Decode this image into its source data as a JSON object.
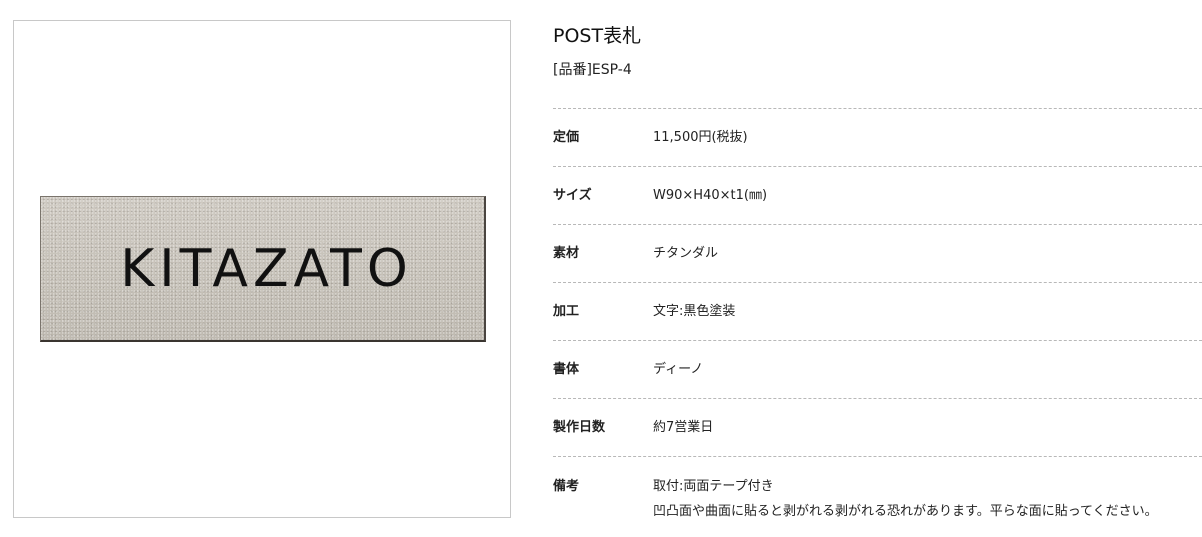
{
  "product": {
    "image_text": "KITAZATO",
    "title": "POST表札",
    "code": "[品番]ESP-4"
  },
  "specs": [
    {
      "label": "定価",
      "value": "11,500円(税抜)"
    },
    {
      "label": "サイズ",
      "value": "W90×H40×t1(㎜)"
    },
    {
      "label": "素材",
      "value": "チタンダル"
    },
    {
      "label": "加工",
      "value": "文字:黒色塗装"
    },
    {
      "label": "書体",
      "value": "ディーノ"
    },
    {
      "label": "製作日数",
      "value": "約7営業日"
    },
    {
      "label": "備考",
      "value_lines": [
        "取付:両面テープ付き",
        "凹凸面や曲面に貼ると剥がれる剥がれる恐れがあります。平らな面に貼ってください。"
      ]
    }
  ],
  "colors": {
    "text": "#222222",
    "divider": "#b8b8b8",
    "plate": "#c9c4bb",
    "plate_text": "#111111"
  }
}
